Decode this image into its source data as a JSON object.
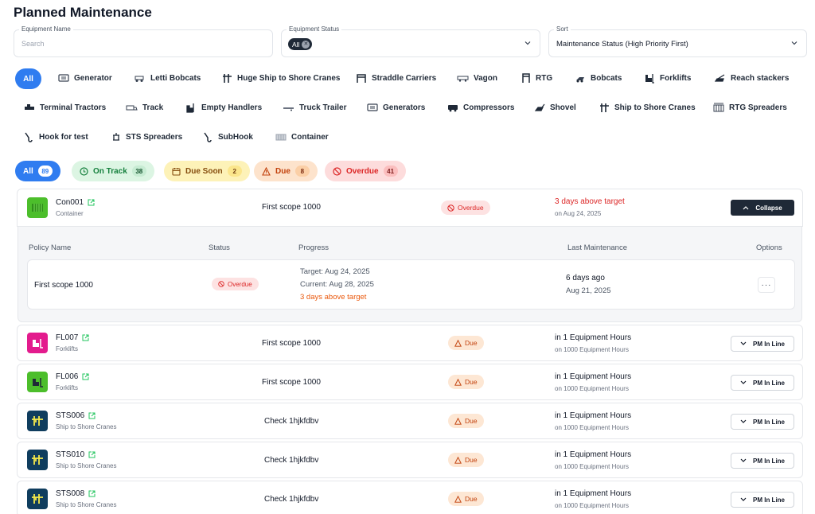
{
  "page": {
    "title": "Planned Maintenance"
  },
  "filters": {
    "equipment_name": {
      "label": "Equipment Name",
      "placeholder": "Search"
    },
    "equipment_status": {
      "label": "Equipment Status",
      "chip": "All"
    },
    "sort": {
      "label": "Sort",
      "value": "Maintenance Status (High Priority First)"
    }
  },
  "categories": {
    "all": "All",
    "items": [
      "Generator",
      "Letti Bobcats",
      "Huge Ship to Shore Cranes",
      "Straddle Carriers",
      "Vagon",
      "RTG",
      "Bobcats",
      "Forklifts",
      "Reach stackers",
      "Terminal Tractors",
      "Track",
      "Empty Handlers",
      "Truck Trailer",
      "Generators",
      "Compressors",
      "Shovel",
      "Ship to Shore Cranes",
      "RTG Spreaders",
      "Hook for test",
      "STS Spreaders",
      "SubHook",
      "Container"
    ]
  },
  "status_tabs": [
    {
      "label": "All",
      "count": "89"
    },
    {
      "label": "On Track",
      "count": "38"
    },
    {
      "label": "Due Soon",
      "count": "2"
    },
    {
      "label": "Due",
      "count": "8"
    },
    {
      "label": "Overdue",
      "count": "41"
    }
  ],
  "colors": {
    "accent": "#2f7cf0",
    "overdue": "#dc2626",
    "due": "#c2410c",
    "on_track": "#15803d",
    "container_icon": "#4cbe2b",
    "forklift_icon": "#e31b8d",
    "crane_icon": "#0f3d5e"
  },
  "rows": [
    {
      "id": "Con001",
      "type": "Container",
      "scope": "First scope 1000",
      "status": "Overdue",
      "due_main": "3 days above target",
      "due_sub": "on Aug 24, 2025",
      "button": "Collapse",
      "icon": "container-icon",
      "detail": {
        "headers": [
          "Policy Name",
          "Status",
          "Progress",
          "Last Maintenance",
          "Options"
        ],
        "policy": "First scope 1000",
        "status": "Overdue",
        "target": "Target: Aug 24, 2025",
        "current": "Current: Aug 28, 2025",
        "progress_note": "3 days above target",
        "last_ago": "6 days ago",
        "last_date": "Aug 21, 2025",
        "options": "···"
      }
    },
    {
      "id": "FL007",
      "type": "Forklifts",
      "scope": "First scope 1000",
      "status": "Due",
      "due_main": "in 1 Equipment Hours",
      "due_sub": "on 1000 Equipment Hours",
      "button": "PM In Line",
      "icon": "forklift-icon"
    },
    {
      "id": "FL006",
      "type": "Forklifts",
      "scope": "First scope 1000",
      "status": "Due",
      "due_main": "in 1 Equipment Hours",
      "due_sub": "on 1000 Equipment Hours",
      "button": "PM In Line",
      "icon": "forklift-icon"
    },
    {
      "id": "STS006",
      "type": "Ship to Shore Cranes",
      "scope": "Check 1hjkfdbv",
      "status": "Due",
      "due_main": "in 1 Equipment Hours",
      "due_sub": "on 1000 Equipment Hours",
      "button": "PM In Line",
      "icon": "crane-icon"
    },
    {
      "id": "STS010",
      "type": "Ship to Shore Cranes",
      "scope": "Check 1hjkfdbv",
      "status": "Due",
      "due_main": "in 1 Equipment Hours",
      "due_sub": "on 1000 Equipment Hours",
      "button": "PM In Line",
      "icon": "crane-icon"
    },
    {
      "id": "STS008",
      "type": "Ship to Shore Cranes",
      "scope": "Check 1hjkfdbv",
      "status": "Due",
      "due_main": "in 1 Equipment Hours",
      "due_sub": "on 1000 Equipment Hours",
      "button": "PM In Line",
      "icon": "crane-icon"
    }
  ]
}
